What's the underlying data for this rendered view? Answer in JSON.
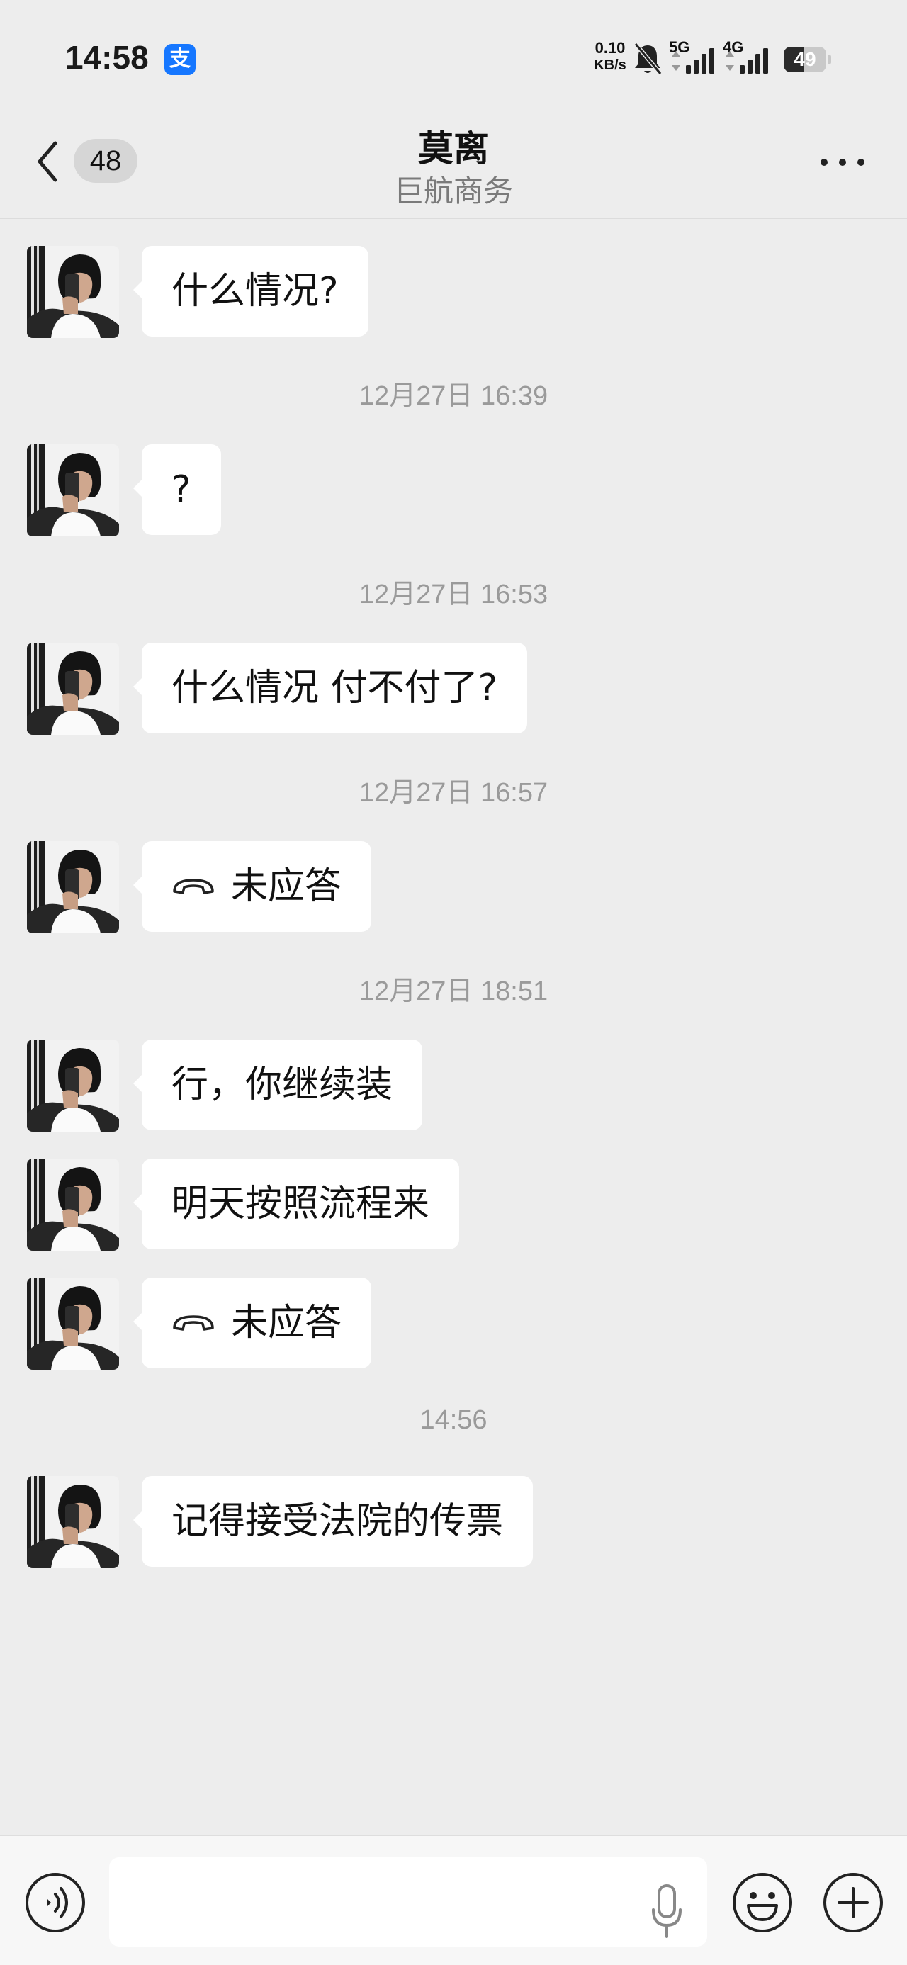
{
  "status_bar": {
    "time": "14:58",
    "app_icon": "alipay-icon",
    "app_icon_glyph": "支",
    "net_speed_value": "0.10",
    "net_speed_unit": "KB/s",
    "signal_1_label": "5G",
    "signal_2_label": "4G",
    "battery_level": "49"
  },
  "header": {
    "back_icon": "chevron-left-icon",
    "unread_count": "48",
    "title": "莫离",
    "subtitle": "巨航商务",
    "more_icon": "more-horizontal-icon"
  },
  "messages": [
    {
      "type": "text",
      "text": "什么情况?"
    },
    {
      "type": "timestamp",
      "text": "12月27日 16:39"
    },
    {
      "type": "text",
      "text": "?"
    },
    {
      "type": "timestamp",
      "text": "12月27日 16:53"
    },
    {
      "type": "text",
      "text": "什么情况 付不付了?"
    },
    {
      "type": "timestamp",
      "text": "12月27日 16:57"
    },
    {
      "type": "call",
      "text": "未应答",
      "icon": "phone-hangup-icon"
    },
    {
      "type": "timestamp",
      "text": "12月27日 18:51"
    },
    {
      "type": "text",
      "text": "行，你继续装"
    },
    {
      "type": "text",
      "text": "明天按照流程来"
    },
    {
      "type": "call",
      "text": "未应答",
      "icon": "phone-hangup-icon"
    },
    {
      "type": "timestamp",
      "text": "14:56"
    },
    {
      "type": "text",
      "text": "记得接受法院的传票"
    }
  ],
  "input_bar": {
    "voice_icon": "voice-icon",
    "input_value": "",
    "input_placeholder": "",
    "mic_icon": "mic-icon",
    "emoji_icon": "emoji-icon",
    "plus_icon": "plus-icon"
  },
  "colors": {
    "background": "#ededed",
    "bubble": "#ffffff",
    "timestamp": "#9a9a9a",
    "subtitle": "#7a7a7a",
    "alipay_blue": "#1677ff"
  }
}
